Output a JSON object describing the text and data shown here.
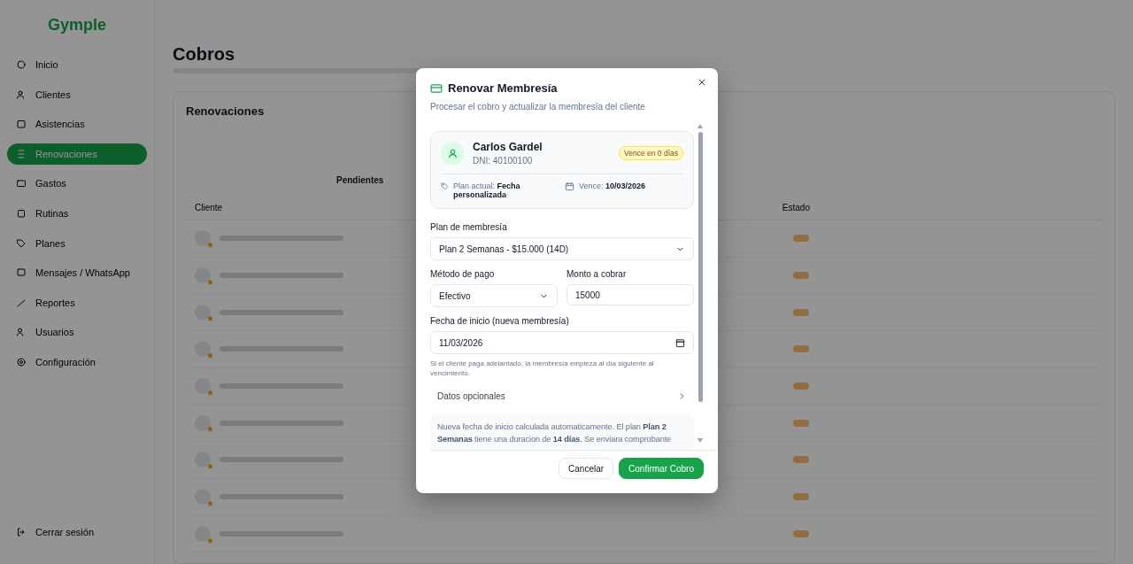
{
  "sidebar": {
    "logo": "Gymple",
    "items": [
      {
        "label": "Inicio",
        "selected": false
      },
      {
        "label": "Clientes",
        "selected": false
      },
      {
        "label": "Asistencias",
        "selected": false
      },
      {
        "label": "Renovaciones",
        "selected": true
      },
      {
        "label": "Gastos",
        "selected": false
      },
      {
        "label": "Rutinas",
        "selected": false
      },
      {
        "label": "Planes",
        "selected": false
      },
      {
        "label": "Mensajes / WhatsApp",
        "selected": false
      },
      {
        "label": "Reportes",
        "selected": false
      },
      {
        "label": "Usuarios",
        "selected": false
      },
      {
        "label": "Configuración",
        "selected": false
      }
    ],
    "logout": "Cerrar sesión"
  },
  "page": {
    "title": "Cobros",
    "section_title": "Renovaciones",
    "filter": "Pendientes",
    "table": {
      "columns": [
        "Cliente",
        "Estado"
      ]
    }
  },
  "dialog": {
    "title": "Renovar Membresía",
    "subtitle": "Procesar el cobro y actualizar la membresía del cliente",
    "client": {
      "name": "Carlos Gardel",
      "dni": "DNI: 40100100",
      "badge": "Vence en 0 días",
      "plan": "Plan actual: **Fecha personalizada**",
      "due": "Vence: **10/03/2026**"
    },
    "plan_field": {
      "label": "Plan de membresía",
      "value": "Plan 2 Semanas - $15.000 (14D)"
    },
    "payment_field": {
      "label": "Método de pago",
      "value": "Efectivo"
    },
    "amount_field": {
      "label": "Monto a cobrar",
      "value": "15000"
    },
    "start_field": {
      "label": "Fecha de inicio (nueva membresía)",
      "value": "11/03/2026"
    },
    "hint": "Si el cliente paga adelantado, la membresía empieza al día siguiente al vencimiento.",
    "optional_section": {
      "label": "Datos opcionales",
      "expanded": false
    },
    "info": "Nueva fecha de inicio calculada automaticamente. El plan **Plan 2 Semanas** tiene una duracion de **14 días**. Se enviara comprobante",
    "cancel": "Cancelar",
    "confirm": "Confirmar Cobro"
  }
}
